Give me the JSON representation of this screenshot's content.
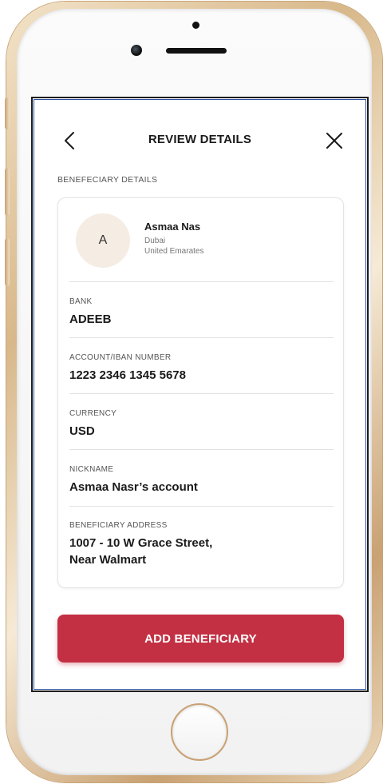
{
  "header": {
    "title": "REVIEW DETAILS",
    "back_icon": "chevron-left-icon",
    "close_icon": "close-icon"
  },
  "section_label": "BENEFECIARY DETAILS",
  "beneficiary": {
    "avatar_initial": "A",
    "name": "Asmaa Nas",
    "city": "Dubai",
    "country": "United Emarates"
  },
  "fields": {
    "bank": {
      "label": "BANK",
      "value": "ADEEB"
    },
    "account": {
      "label": "ACCOUNT/IBAN NUMBER",
      "value": "1223 2346 1345 5678"
    },
    "currency": {
      "label": "CURRENCY",
      "value": "USD"
    },
    "nickname": {
      "label": "NICKNAME",
      "value": "Asmaa Nasr’s account"
    },
    "address": {
      "label": "BENEFICIARY ADDRESS",
      "line1": "1007 - 10 W Grace Street,",
      "line2": "Near Walmart"
    }
  },
  "actions": {
    "add_beneficiary": "ADD BENEFICIARY"
  },
  "colors": {
    "primary": "#c33043",
    "avatar_bg": "#f5ece3",
    "frame_gold": "#d8b88a"
  }
}
